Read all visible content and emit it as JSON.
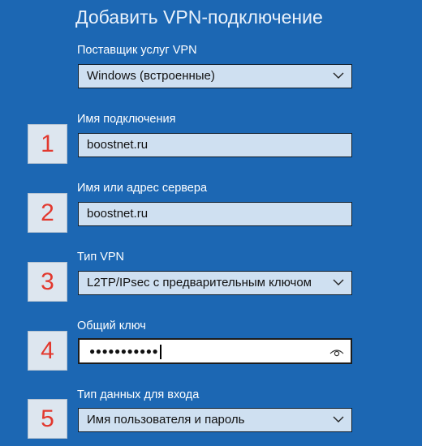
{
  "page": {
    "title": "Добавить VPN-подключение"
  },
  "provider": {
    "label": "Поставщик услуг VPN",
    "value": "Windows (встроенные)",
    "icon": "chevron-down-icon"
  },
  "connection_name": {
    "label": "Имя подключения",
    "value": "boostnet.ru"
  },
  "server": {
    "label": "Имя или адрес сервера",
    "value": "boostnet.ru"
  },
  "vpn_type": {
    "label": "Тип VPN",
    "value": "L2TP/IPsec с предварительным ключом",
    "icon": "chevron-down-icon"
  },
  "shared_key": {
    "label": "Общий ключ",
    "value": "●●●●●●●●●●●",
    "icon": "eye-icon"
  },
  "signin_type": {
    "label": "Тип данных для входа",
    "value": "Имя пользователя и пароль",
    "icon": "chevron-down-icon"
  },
  "step_badges": [
    "1",
    "2",
    "3",
    "4",
    "5"
  ],
  "colors": {
    "background": "#1c67b3",
    "field": "#cfe0f1",
    "badge_text": "#e2382e"
  }
}
